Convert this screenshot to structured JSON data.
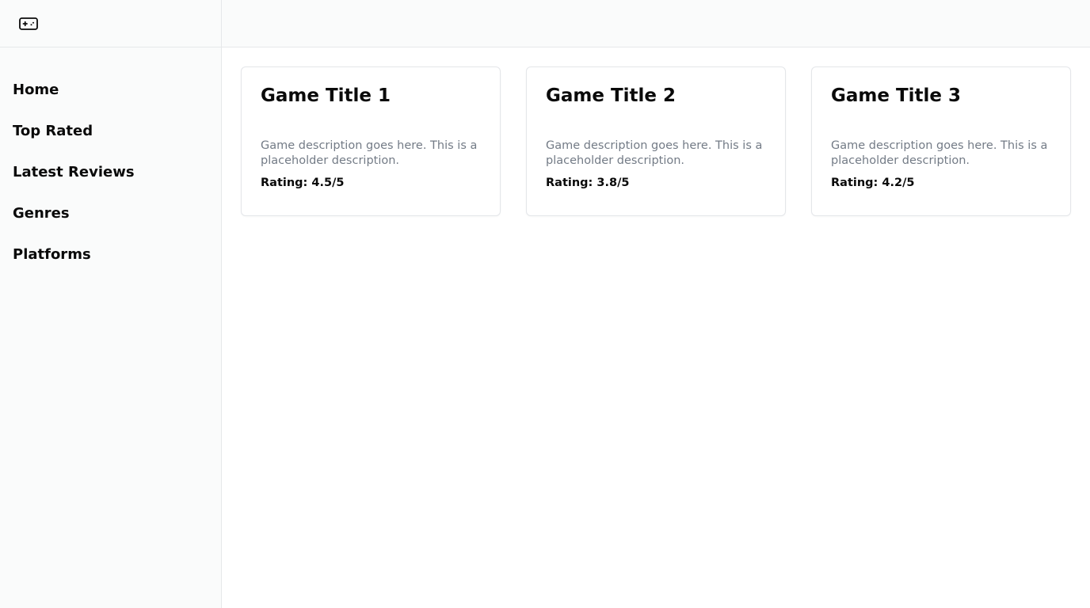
{
  "app": {
    "logo_icon": "gamepad-icon"
  },
  "sidebar": {
    "items": [
      {
        "label": "Home"
      },
      {
        "label": "Top Rated"
      },
      {
        "label": "Latest Reviews"
      },
      {
        "label": "Genres"
      },
      {
        "label": "Platforms"
      }
    ]
  },
  "games": [
    {
      "title": "Game Title 1",
      "description": "Game description goes here. This is a placeholder description.",
      "rating": "Rating: 4.5/5"
    },
    {
      "title": "Game Title 2",
      "description": "Game description goes here. This is a placeholder description.",
      "rating": "Rating: 3.8/5"
    },
    {
      "title": "Game Title 3",
      "description": "Game description goes here. This is a placeholder description.",
      "rating": "Rating: 4.2/5"
    }
  ],
  "colors": {
    "sidebar_bg": "#fafbfb",
    "border": "#e6e8ea",
    "text_primary": "#0a0a0a",
    "text_muted": "#737b86"
  }
}
